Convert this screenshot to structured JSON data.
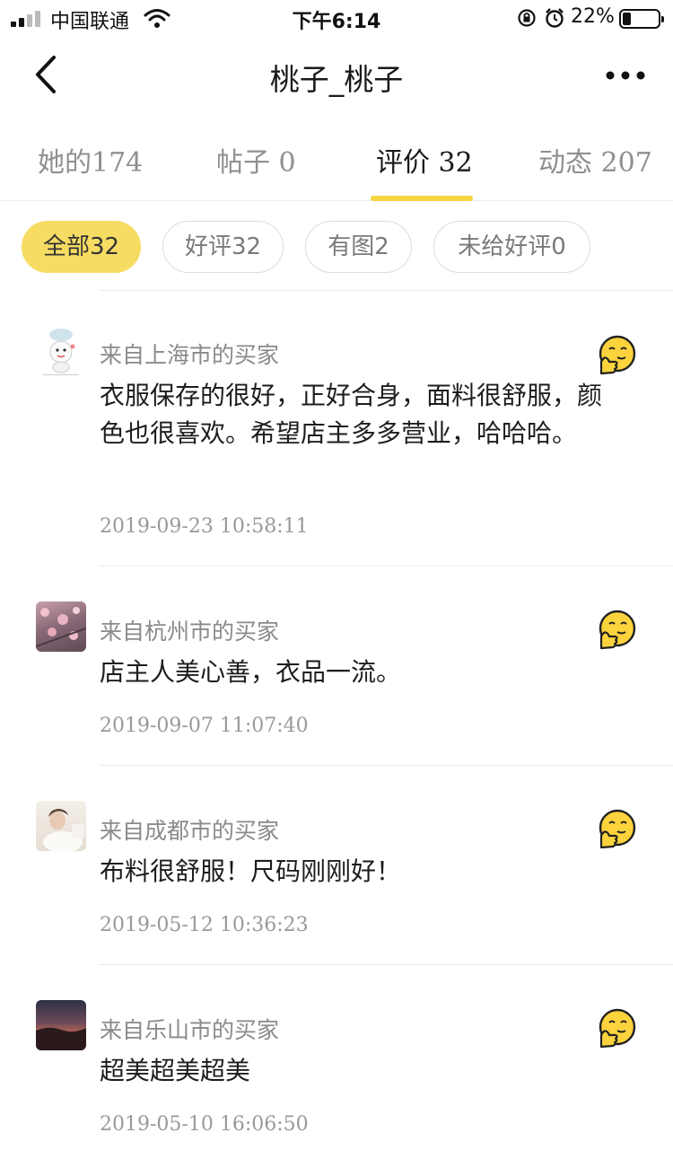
{
  "status_bar": {
    "carrier": "中国联通",
    "time": "下午6:14",
    "battery_percent": "22%",
    "battery_level": 0.22
  },
  "nav": {
    "title": "桃子_桃子",
    "back_icon": "chevron-left-icon",
    "more_icon": "more-dots-icon"
  },
  "tabs": [
    {
      "label": "她的",
      "count": "174"
    },
    {
      "label": "帖子",
      "count": "0"
    },
    {
      "label": "评价",
      "count": "32",
      "active": true
    },
    {
      "label": "动态",
      "count": "207"
    }
  ],
  "filters": [
    {
      "label": "全部32",
      "active": true
    },
    {
      "label": "好评32"
    },
    {
      "label": "有图2"
    },
    {
      "label": "未给好评0"
    }
  ],
  "reviews": [
    {
      "from": "来自上海市的买家",
      "text": "衣服保存的很好，正好合身，面料很舒服，颜色也很喜欢。希望店主多多营业，哈哈哈。",
      "time": "2019-09-23 10:58:11",
      "avatar": "cartoon-avatar",
      "rating_icon": "thumbs-up-emoji-icon"
    },
    {
      "from": "来自杭州市的买家",
      "text": "店主人美心善，衣品一流。",
      "time": "2019-09-07 11:07:40",
      "avatar": "blossom-photo-avatar",
      "rating_icon": "thumbs-up-emoji-icon"
    },
    {
      "from": "来自成都市的买家",
      "text": "布料很舒服！尺码刚刚好！",
      "time": "2019-05-12 10:36:23",
      "avatar": "person-photo-avatar",
      "rating_icon": "thumbs-up-emoji-icon"
    },
    {
      "from": "来自乐山市的买家",
      "text": "超美超美超美",
      "time": "2019-05-10 16:06:50",
      "avatar": "sunset-photo-avatar",
      "rating_icon": "thumbs-up-emoji-icon"
    }
  ],
  "colors": {
    "accent": "#f7dc63",
    "tab_underline": "#f5d640"
  }
}
